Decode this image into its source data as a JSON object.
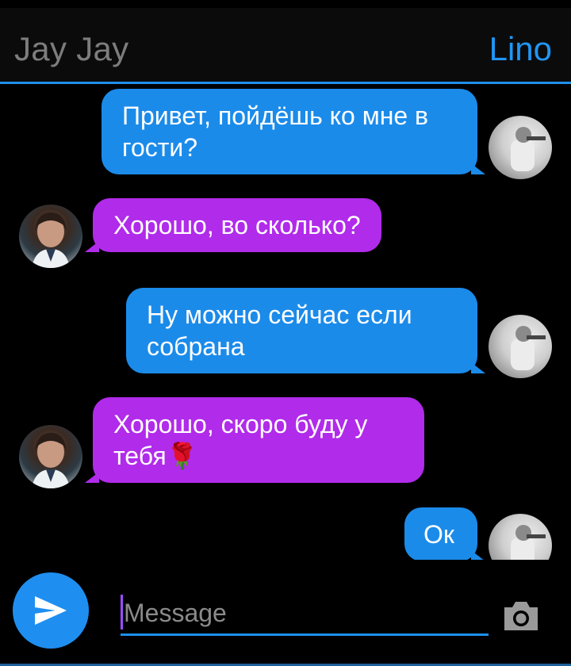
{
  "header": {
    "contact_name": "Jay Jay",
    "user_name": "Lino"
  },
  "messages": [
    {
      "from": "Lino",
      "side": "right",
      "text": "Привет, пойдёшь ко мне в гости?"
    },
    {
      "from": "Jay Jay",
      "side": "left",
      "text": "Хорошо, во сколько?"
    },
    {
      "from": "Lino",
      "side": "right",
      "text": "Ну можно сейчас если собрана"
    },
    {
      "from": "Jay Jay",
      "side": "left",
      "text": "Хорошо, скоро буду у тебя🌹"
    },
    {
      "from": "Lino",
      "side": "right",
      "text": "Ок"
    }
  ],
  "composer": {
    "placeholder": "Message",
    "send_icon": "send-icon",
    "camera_icon": "camera-icon"
  },
  "colors": {
    "accent": "#1e8ff0",
    "outgoing_bubble": "#1b8bea",
    "incoming_bubble": "#b12bea",
    "background": "#000000"
  }
}
